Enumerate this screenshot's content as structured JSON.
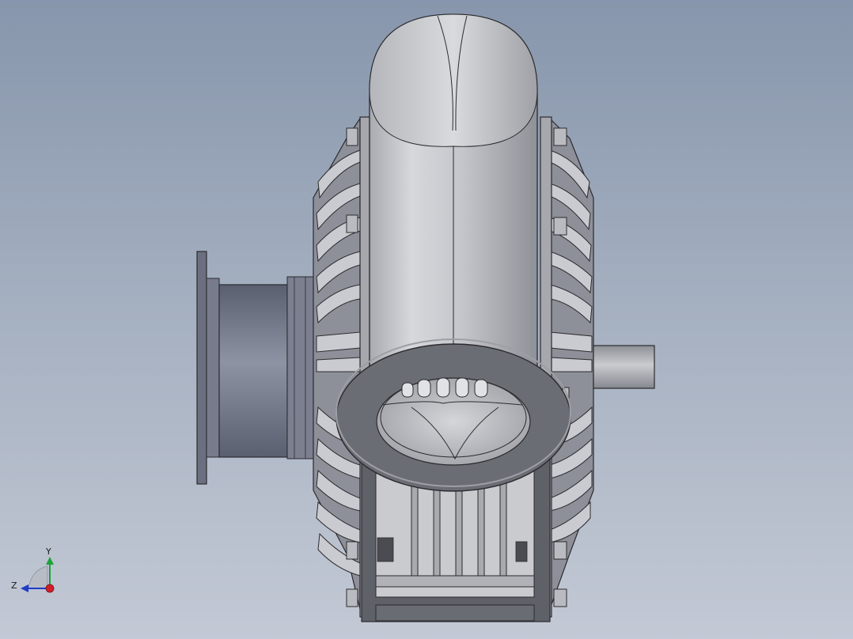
{
  "triad": {
    "y_label": "Y",
    "z_label": "Z",
    "y_color": "#1ea23a",
    "z_color": "#1f3cc8",
    "x_color": "#d0202a"
  },
  "colors": {
    "background_top": "#8796ac",
    "background_bottom": "#c3c9d5",
    "body_light": "#d2d4d8",
    "body_shade": "#9a9ca3",
    "flange": "#6c6e76",
    "inlet": "#6c7184"
  }
}
